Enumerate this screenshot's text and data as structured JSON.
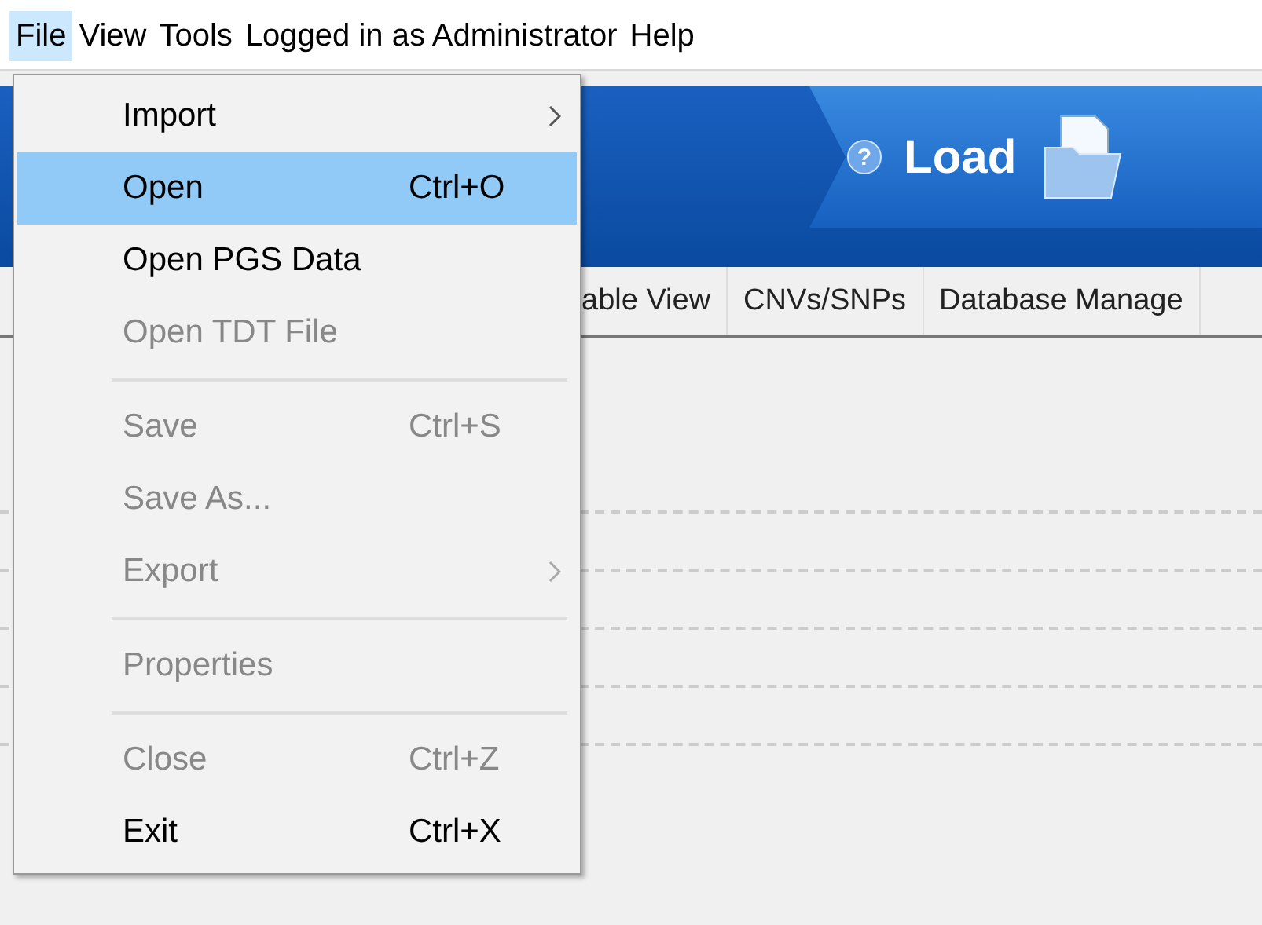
{
  "menubar": [
    {
      "label": "File",
      "selected": true
    },
    {
      "label": "View",
      "selected": false
    },
    {
      "label": "Tools",
      "selected": false
    },
    {
      "label": "Logged in as Administrator",
      "selected": false
    },
    {
      "label": "Help",
      "selected": false
    }
  ],
  "banner": {
    "help_glyph": "?",
    "button": "Load"
  },
  "tabs": [
    {
      "label": "able View"
    },
    {
      "label": "CNVs/SNPs"
    },
    {
      "label": "Database Manage"
    }
  ],
  "file_menu": [
    {
      "kind": "item",
      "label": "Import",
      "submenu": true,
      "disabled": false,
      "selected": false
    },
    {
      "kind": "item",
      "label": "Open",
      "shortcut": "Ctrl+O",
      "disabled": false,
      "selected": true
    },
    {
      "kind": "item",
      "label": "Open PGS Data",
      "disabled": false,
      "selected": false
    },
    {
      "kind": "item",
      "label": "Open TDT File",
      "disabled": true,
      "selected": false
    },
    {
      "kind": "separator"
    },
    {
      "kind": "item",
      "label": "Save",
      "shortcut": "Ctrl+S",
      "disabled": true,
      "selected": false
    },
    {
      "kind": "item",
      "label": "Save As...",
      "disabled": true,
      "selected": false
    },
    {
      "kind": "item",
      "label": "Export",
      "submenu": true,
      "disabled": true,
      "selected": false
    },
    {
      "kind": "separator"
    },
    {
      "kind": "item",
      "label": "Properties",
      "disabled": true,
      "selected": false
    },
    {
      "kind": "separator"
    },
    {
      "kind": "item",
      "label": "Close",
      "shortcut": "Ctrl+Z",
      "disabled": true,
      "selected": false
    },
    {
      "kind": "item",
      "label": "Exit",
      "shortcut": "Ctrl+X",
      "disabled": false,
      "selected": false
    }
  ]
}
